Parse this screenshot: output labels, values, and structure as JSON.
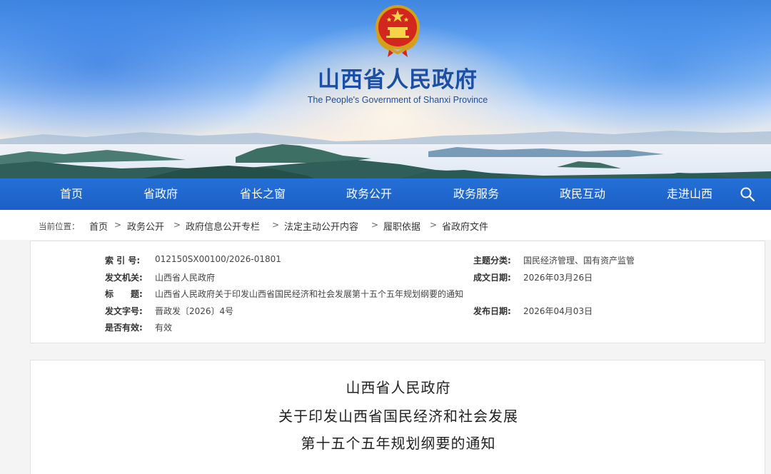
{
  "header": {
    "title": "山西省人民政府",
    "subtitle": "The People's Government of Shanxi Province",
    "emblem_icon": "national-emblem-icon"
  },
  "nav": {
    "items": [
      "首页",
      "省政府",
      "省长之窗",
      "政务公开",
      "政务服务",
      "政民互动",
      "走进山西"
    ],
    "search_icon": "search-icon",
    "background": "#1e63c8"
  },
  "breadcrumb": {
    "lead": "当前位置：",
    "items": [
      "首页",
      "政务公开",
      "政府信息公开专栏",
      "法定主动公开内容",
      "履职依据",
      "省政府文件"
    ],
    "separator": ">"
  },
  "meta": {
    "index_label": "索 引 号:",
    "index_value": "012150SX00100/2026-01801",
    "topic_label": "主题分类:",
    "topic_value": "国民经济管理、国有资产监管",
    "issuer_label": "发文机关:",
    "issuer_value": "山西省人民政府",
    "created_label": "成文日期:",
    "created_value": "2026年03月26日",
    "title_label": "标　　题:",
    "title_value": "山西省人民政府关于印发山西省国民经济和社会发展第十五个五年规划纲要的通知",
    "docno_label": "发文字号:",
    "docno_value": "晋政发〔2026〕4号",
    "published_label": "发布日期:",
    "published_value": "2026年04月03日",
    "valid_label": "是否有效:",
    "valid_value": "有效"
  },
  "article": {
    "title_lines": [
      "山西省人民政府",
      "关于印发山西省国民经济和社会发展",
      "第十五个五年规划纲要的通知"
    ]
  }
}
